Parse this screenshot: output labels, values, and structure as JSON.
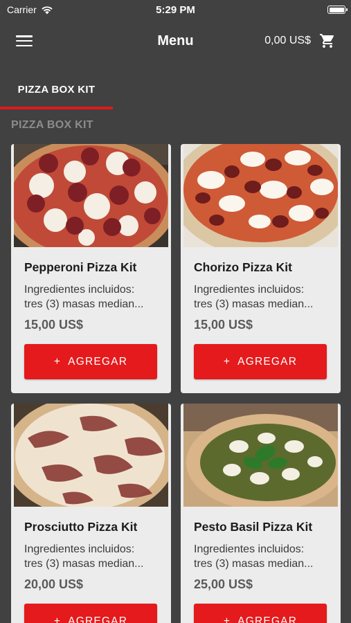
{
  "status_bar": {
    "carrier": "Carrier",
    "time": "5:29 PM"
  },
  "header": {
    "title": "Menu",
    "cart_total": "0,00 US$"
  },
  "tabs": [
    {
      "label": "PIZZA BOX KIT",
      "active": true
    }
  ],
  "section": {
    "title": "PIZZA BOX KIT"
  },
  "add_label": "AGREGAR",
  "add_icon": "+",
  "products": [
    {
      "name": "Pepperoni Pizza Kit",
      "desc_line1": "Ingredientes incluidos:",
      "desc_line2": "tres (3) masas median...",
      "price": "15,00 US$"
    },
    {
      "name": "Chorizo Pizza Kit",
      "desc_line1": "Ingredientes incluidos:",
      "desc_line2": "tres (3) masas median...",
      "price": "15,00 US$"
    },
    {
      "name": "Prosciutto Pizza Kit",
      "desc_line1": "Ingredientes incluidos:",
      "desc_line2": "tres (3) masas median...",
      "price": "20,00 US$"
    },
    {
      "name": "Pesto Basil Pizza Kit",
      "desc_line1": "Ingredientes incluidos:",
      "desc_line2": "tres (3) masas median...",
      "price": "25,00 US$"
    }
  ],
  "colors": {
    "background": "#414141",
    "accent": "#e41a1c",
    "card": "#ececec"
  }
}
